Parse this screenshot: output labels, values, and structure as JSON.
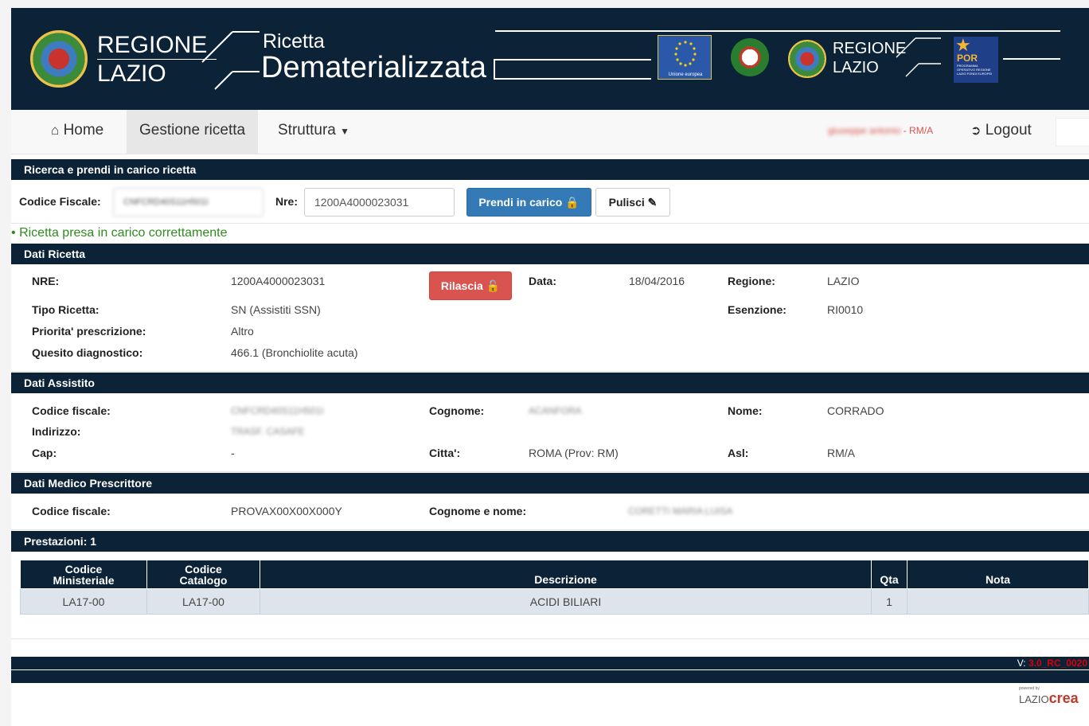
{
  "header": {
    "brand_line1": "REGIONE",
    "brand_line2": "LAZIO",
    "title_small": "Ricetta",
    "title_large": "Dematerializzata",
    "eu_label": "Unione europea",
    "right_brand_line1": "REGIONE",
    "right_brand_line2": "LAZIO",
    "por_label": "POR",
    "por_sub": "PROGRAMMA OPERATIVO REGIONE LAZIO FONDI EUROPEI"
  },
  "nav": {
    "home": "Home",
    "gestione": "Gestione ricetta",
    "struttura": "Struttura",
    "user": "giuseppe antonio",
    "user_suffix": " - RM/A",
    "logout": "Logout"
  },
  "search": {
    "section_title": "Ricerca e prendi in carico ricetta",
    "cf_label": "Codice Fiscale:",
    "cf_value": "CNFCRD40S11H501I",
    "nre_label": "Nre:",
    "nre_value": "1200A4000023031",
    "take_button": "Prendi in carico",
    "clear_button": "Pulisci"
  },
  "message": "Ricetta presa in carico correttamente",
  "ricetta": {
    "section_title": "Dati Ricetta",
    "nre_label": "NRE:",
    "nre_value": "1200A4000023031",
    "release_button": "Rilascia",
    "data_label": "Data:",
    "data_value": "18/04/2016",
    "regione_label": "Regione:",
    "regione_value": "LAZIO",
    "tipo_label": "Tipo Ricetta:",
    "tipo_value": "SN (Assistiti SSN)",
    "esenzione_label": "Esenzione:",
    "esenzione_value": "RI0010",
    "priorita_label": "Priorita' prescrizione:",
    "priorita_value": "Altro",
    "quesito_label": "Quesito diagnostico:",
    "quesito_value": "466.1 (Bronchiolite acuta)"
  },
  "assistito": {
    "section_title": "Dati Assistito",
    "cf_label": "Codice fiscale:",
    "cf_value": "CNFCRD40S11H501I",
    "cognome_label": "Cognome:",
    "cognome_value": "ACANFORA",
    "nome_label": "Nome:",
    "nome_value": "CORRADO",
    "indirizzo_label": "Indirizzo:",
    "indirizzo_value": "TRASF. CASAFE",
    "cap_label": "Cap:",
    "cap_value": "-",
    "citta_label": "Citta':",
    "citta_value": "ROMA (Prov: RM)",
    "asl_label": "Asl:",
    "asl_value": "RM/A"
  },
  "medico": {
    "section_title": "Dati Medico Prescrittore",
    "cf_label": "Codice fiscale:",
    "cf_value": "PROVAX00X00X000Y",
    "nome_label": "Cognome e nome:",
    "nome_value": "CORETTI MARIA LUISA"
  },
  "prestazioni": {
    "section_title": "Prestazioni: 1",
    "headers": [
      "Codice Ministeriale",
      "Codice Catalogo",
      "Descrizione",
      "Qta",
      "Nota"
    ],
    "h_cod_min_1": "Codice",
    "h_cod_min_2": "Ministeriale",
    "h_cod_cat_1": "Codice",
    "h_cod_cat_2": "Catalogo",
    "h_desc": "Descrizione",
    "h_qta": "Qta",
    "h_nota": "Nota",
    "rows": [
      {
        "cod_min": "LA17-00",
        "cod_cat": "LA17-00",
        "desc": "ACIDI BILIARI",
        "qta": "1",
        "nota": ""
      }
    ]
  },
  "footer": {
    "version_prefix": "V: ",
    "version": "3.0_RC_0020",
    "powered_by": "powered by",
    "lazio": "LAZIO",
    "crea": "crea"
  },
  "colors": {
    "navy": "#0b2237",
    "primary": "#337ab7",
    "danger": "#d9534f",
    "success": "#2e8b1e"
  }
}
